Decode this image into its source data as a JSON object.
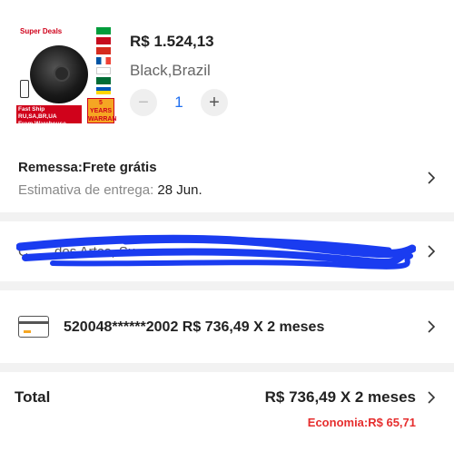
{
  "product": {
    "image_badge_deal": "Super Deals",
    "image_badge_ship": "Fast Ship RU,SA,BR,UA From Warehouse",
    "image_badge_warranty": "5 YEARS WARRANTY",
    "price": "R$ 1.524,13",
    "variant": "Black,Brazil",
    "quantity": "1",
    "minus_label": "−",
    "plus_label": "+"
  },
  "shipping": {
    "title": "Remessa:Frete grátis",
    "estimate_label": "Estimativa de entrega: ",
    "estimate_date": "28 Jun."
  },
  "address": {
    "text": "C... ...dos Artes, Su..."
  },
  "payment": {
    "card_icon": "credit-card-icon",
    "summary": "520048******2002  R$ 736,49 X 2 meses"
  },
  "total": {
    "label": "Total",
    "value": "R$ 736,49 X 2 meses",
    "savings": "Economia:R$ 65,71"
  },
  "colors": {
    "accent_blue": "#1f6ff0",
    "savings_red": "#e62e2e",
    "scribble_blue": "#1a3cf0",
    "divider": "#f2f2f2"
  }
}
